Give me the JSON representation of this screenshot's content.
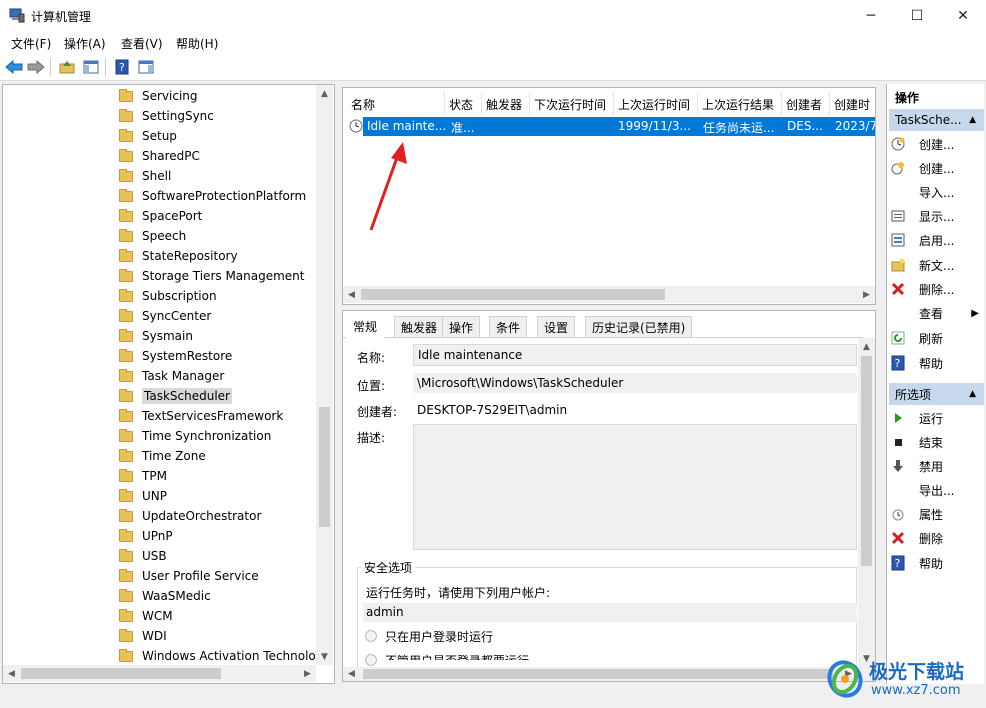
{
  "window": {
    "title": "计算机管理",
    "minimize": "─",
    "maximize": "☐",
    "close": "✕"
  },
  "menu": [
    "文件(F)",
    "操作(A)",
    "查看(V)",
    "帮助(H)"
  ],
  "tree": {
    "items": [
      "Servicing",
      "SettingSync",
      "Setup",
      "SharedPC",
      "Shell",
      "SoftwareProtectionPlatform",
      "SpacePort",
      "Speech",
      "StateRepository",
      "Storage Tiers Management",
      "Subscription",
      "SyncCenter",
      "Sysmain",
      "SystemRestore",
      "Task Manager",
      "TaskScheduler",
      "TextServicesFramework",
      "Time Synchronization",
      "Time Zone",
      "TPM",
      "UNP",
      "UpdateOrchestrator",
      "UPnP",
      "USB",
      "User Profile Service",
      "WaaSMedic",
      "WCM",
      "WDI",
      "Windows Activation Technolog"
    ],
    "selected": "TaskScheduler"
  },
  "task_list": {
    "columns": [
      "名称",
      "状态",
      "触发器",
      "下次运行时间",
      "上次运行时间",
      "上次运行结果",
      "创建者",
      "创建时"
    ],
    "rows": [
      {
        "name": "Idle mainte...",
        "status": "准...",
        "trigger": "",
        "next_run": "",
        "last_run": "1999/11/3...",
        "last_result": "任务尚未运...",
        "author": "DES...",
        "created": "2023/7"
      }
    ]
  },
  "details": {
    "tabs": [
      "常规",
      "触发器",
      "操作",
      "条件",
      "设置",
      "历史记录(已禁用)"
    ],
    "active_tab": "常规",
    "name_label": "名称:",
    "name_value": "Idle maintenance",
    "location_label": "位置:",
    "location_value": "\\Microsoft\\Windows\\TaskScheduler",
    "author_label": "创建者:",
    "author_value": "DESKTOP-7S29EIT\\admin",
    "desc_label": "描述:",
    "security_title": "安全选项",
    "run_as_label": "运行任务时，请使用下列用户帐户:",
    "run_as_user": "admin",
    "radio1": "只在用户登录时运行",
    "radio2": "不管用户是否登录都要运行"
  },
  "actions": {
    "header": "操作",
    "section1": "TaskSche...",
    "items1": [
      {
        "label": "创建...",
        "icon": "create-basic-task-icon"
      },
      {
        "label": "创建...",
        "icon": "create-task-icon"
      },
      {
        "label": "导入...",
        "icon": ""
      },
      {
        "label": "显示...",
        "icon": "display-running-tasks-icon"
      },
      {
        "label": "启用...",
        "icon": "enable-history-icon"
      },
      {
        "label": "新文...",
        "icon": "new-folder-icon"
      },
      {
        "label": "删除...",
        "icon": "delete-folder-icon"
      },
      {
        "label": "查看",
        "icon": ""
      },
      {
        "label": "刷新",
        "icon": "refresh-icon"
      },
      {
        "label": "帮助",
        "icon": "help-icon"
      }
    ],
    "section2": "所选项",
    "items2": [
      {
        "label": "运行",
        "icon": "run-icon"
      },
      {
        "label": "结束",
        "icon": "end-icon"
      },
      {
        "label": "禁用",
        "icon": "disable-icon"
      },
      {
        "label": "导出...",
        "icon": ""
      },
      {
        "label": "属性",
        "icon": "properties-icon"
      },
      {
        "label": "删除",
        "icon": "delete-icon"
      },
      {
        "label": "帮助",
        "icon": "help-icon"
      }
    ]
  },
  "watermark": {
    "text": "极光下载站",
    "url": "www.xz7.com"
  },
  "colors": {
    "selection": "#0078d7",
    "section_header": "#c7d8ec",
    "annotation_arrow": "#e02020"
  }
}
